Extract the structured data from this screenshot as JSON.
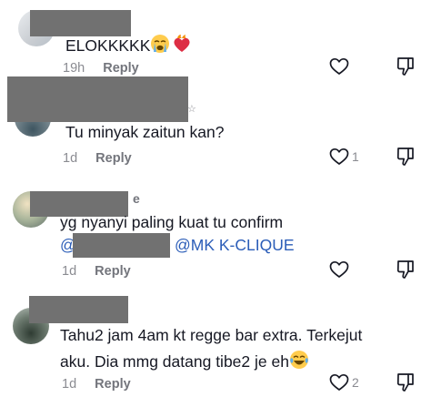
{
  "comments": [
    {
      "text": "ELOKKKKK",
      "time": "19h",
      "reply": "Reply",
      "likes": ""
    },
    {
      "text": "Tu minyak zaitun kan?",
      "time": "1d",
      "reply": "Reply",
      "likes": "1"
    },
    {
      "text": "yg nyanyi paling kuat tu confirm",
      "username_fragment": "e",
      "mention_prefix": "@",
      "mention": "@MK K-CLIQUE",
      "time": "1d",
      "reply": "Reply",
      "likes": ""
    },
    {
      "text_line1": "Tahu2 jam 4am kt regge bar extra. Terkejut",
      "text_line2": "aku. Dia mmg datang tibe2 je eh",
      "time": "1d",
      "reply": "Reply",
      "likes": "2"
    }
  ],
  "icons": {
    "like": "heart-outline-icon",
    "dislike": "thumbs-down-icon",
    "emoji_crying": "loudly-crying-face-icon",
    "emoji_heart": "heart-on-fire-icon",
    "emoji_laugh": "tears-of-joy-icon"
  },
  "colors": {
    "text": "#161823",
    "muted": "#8a8b91",
    "mention": "#2b5db8",
    "redaction": "#717171"
  }
}
